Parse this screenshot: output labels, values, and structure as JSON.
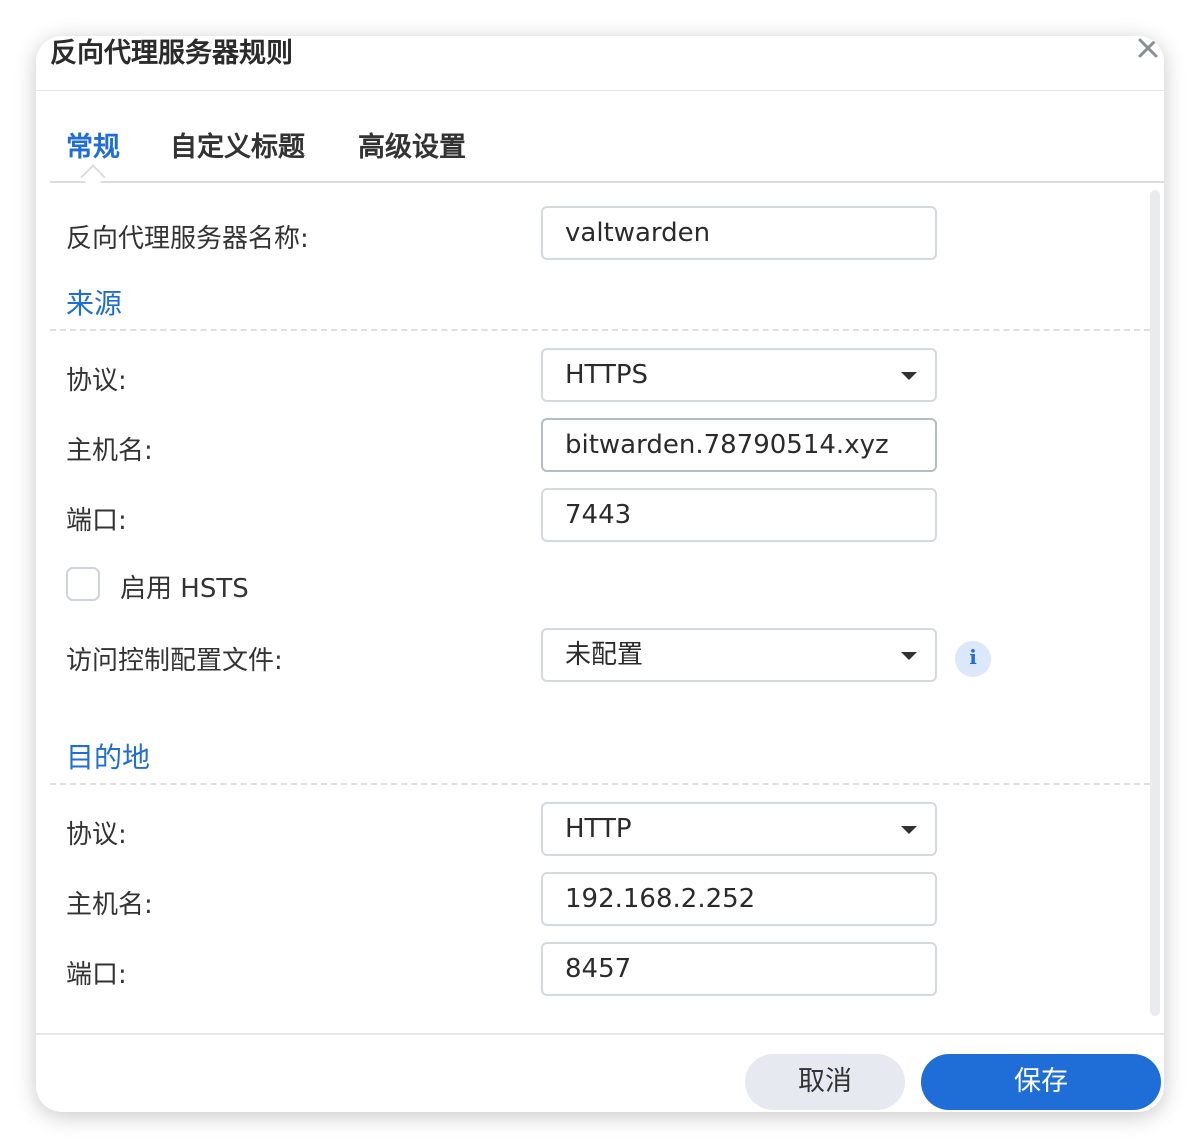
{
  "dialog": {
    "title": "反向代理服务器规则",
    "close_icon": "close-icon"
  },
  "tabs": [
    {
      "label": "常规",
      "active": true
    },
    {
      "label": "自定义标题",
      "active": false
    },
    {
      "label": "高级设置",
      "active": false
    }
  ],
  "general": {
    "name_label": "反向代理服务器名称:",
    "name_value": "valtwarden",
    "source": {
      "section_title": "来源",
      "protocol_label": "协议:",
      "protocol_value": "HTTPS",
      "hostname_label": "主机名:",
      "hostname_value": "bitwarden.78790514.xyz",
      "port_label": "端口:",
      "port_value": "7443",
      "hsts_label": "启用 HSTS",
      "hsts_checked": false,
      "acl_label": "访问控制配置文件:",
      "acl_value": "未配置",
      "info_icon": "info-icon"
    },
    "destination": {
      "section_title": "目的地",
      "protocol_label": "协议:",
      "protocol_value": "HTTP",
      "hostname_label": "主机名:",
      "hostname_value": "192.168.2.252",
      "port_label": "端口:",
      "port_value": "8457"
    }
  },
  "footer": {
    "cancel_label": "取消",
    "save_label": "保存"
  },
  "colors": {
    "accent": "#1f6ed8",
    "cancel_bg": "#e6eaf0",
    "info_bg": "#dbe7fb"
  }
}
